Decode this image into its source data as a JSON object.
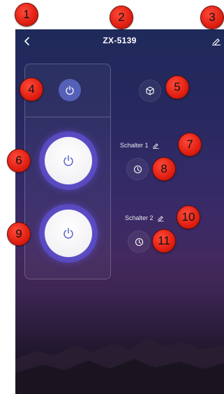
{
  "header": {
    "title": "ZX-5139"
  },
  "switches": [
    {
      "label": "Schalter 1"
    },
    {
      "label": "Schalter 2"
    }
  ],
  "icons": {
    "back": "chevron-left-icon",
    "edit": "pencil-icon",
    "all_power": "power-icon",
    "scene": "cube-icon",
    "timer": "clock-icon"
  },
  "colors": {
    "accent": "#5560b8",
    "power_ring": "#5b4cc4",
    "badge": "#e01f12"
  },
  "badges": [
    "1",
    "2",
    "3",
    "4",
    "5",
    "6",
    "7",
    "8",
    "9",
    "10",
    "11"
  ]
}
